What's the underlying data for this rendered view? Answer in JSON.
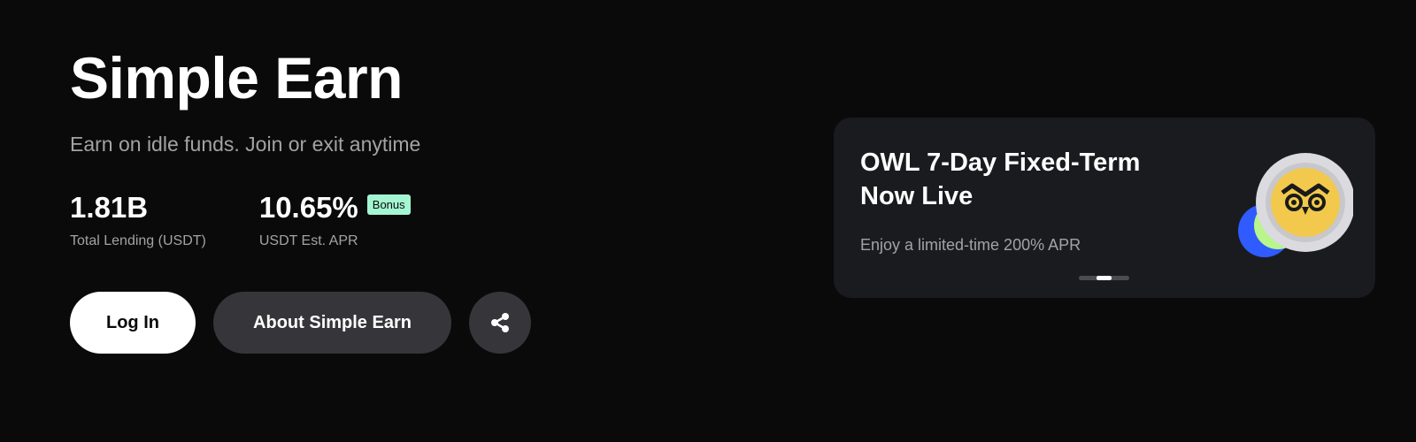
{
  "hero": {
    "title": "Simple Earn",
    "subtitle": "Earn on idle funds. Join or exit anytime"
  },
  "stats": {
    "total_lending": {
      "value": "1.81B",
      "label": "Total Lending (USDT)"
    },
    "apr": {
      "value": "10.65%",
      "badge": "Bonus",
      "label": "USDT Est. APR"
    }
  },
  "actions": {
    "login_label": "Log In",
    "about_label": "About Simple Earn",
    "share_icon": "share-icon"
  },
  "promo": {
    "title": "OWL 7-Day Fixed-Term Now Live",
    "description": "Enjoy a limited-time 200% APR",
    "carousel": {
      "slides": 3,
      "active_index": 1
    }
  },
  "colors": {
    "background": "#0a0a0a",
    "card": "#1a1b1e",
    "button_dark": "#36363a",
    "badge": "#a4f5d2",
    "owl_yellow": "#f2c94c",
    "coin_blue": "#2f5bff",
    "coin_green": "#b8f58a"
  }
}
